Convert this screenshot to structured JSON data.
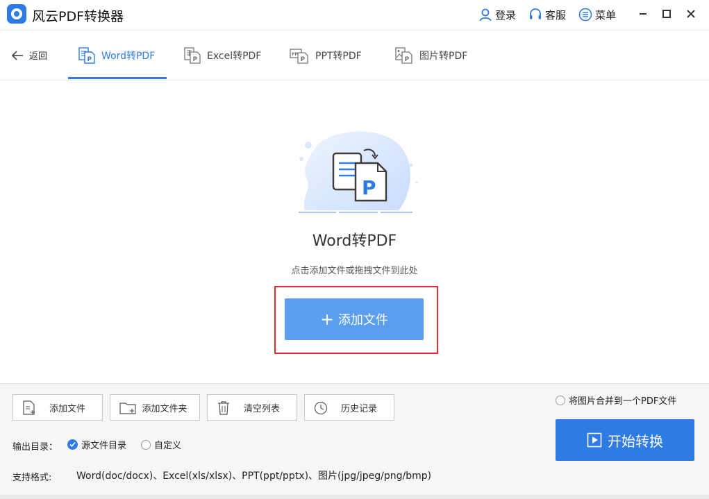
{
  "app": {
    "title": "风云PDF转换器"
  },
  "top_actions": {
    "login": "登录",
    "service": "客服",
    "menu": "菜单"
  },
  "nav": {
    "back": "返回",
    "tabs": [
      {
        "label": "Word转PDF",
        "icon": "word-to-pdf-icon",
        "active": true
      },
      {
        "label": "Excel转PDF",
        "icon": "excel-to-pdf-icon",
        "active": false
      },
      {
        "label": "PPT转PDF",
        "icon": "ppt-to-pdf-icon",
        "active": false
      },
      {
        "label": "图片转PDF",
        "icon": "image-to-pdf-icon",
        "active": false
      }
    ]
  },
  "main": {
    "title": "Word转PDF",
    "hint": "点击添加文件或拖拽文件到此处",
    "add_button": "添加文件"
  },
  "toolbar": {
    "add_file": "添加文件",
    "add_folder": "添加文件夹",
    "clear_list": "清空列表",
    "history": "历史记录"
  },
  "options": {
    "merge_images": "将图片合并到一个PDF文件",
    "output_label": "输出目录：",
    "output_source": "源文件目录",
    "output_custom": "自定义",
    "output_selected": "源文件目录"
  },
  "formats": {
    "label": "支持格式:",
    "value": "Word(doc/docx)、Excel(xls/xlsx)、PPT(ppt/pptx)、图片(jpg/jpeg/png/bmp)"
  },
  "start_button": "开始转换",
  "colors": {
    "accent": "#2f7be5",
    "button_light": "#5b9ef0",
    "highlight": "#e02d2d"
  }
}
